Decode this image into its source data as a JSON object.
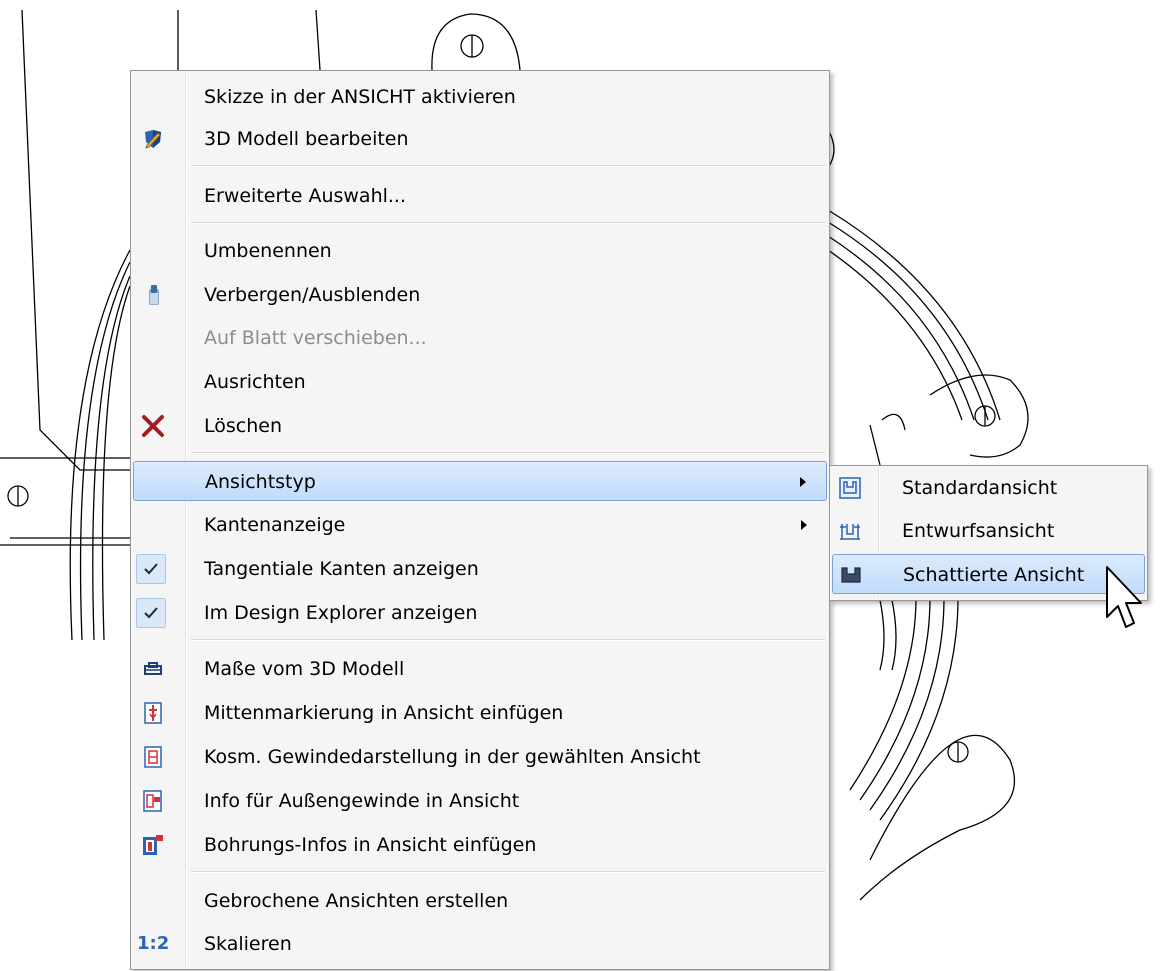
{
  "context_menu": {
    "items": {
      "skizze": "Skizze in der ANSICHT aktivieren",
      "modell": "3D Modell bearbeiten",
      "erweiterte": "Erweiterte Auswahl...",
      "umbenennen": "Umbenennen",
      "verbergen": "Verbergen/Ausblenden",
      "blatt": "Auf Blatt verschieben...",
      "ausrichten": "Ausrichten",
      "loeschen": "Löschen",
      "ansichtstyp": "Ansichtstyp",
      "kanten": "Kantenanzeige",
      "tangential": "Tangentiale Kanten anzeigen",
      "design_explorer": "Im Design Explorer anzeigen",
      "masse": "Maße vom 3D Modell",
      "mitten": "Mittenmarkierung in Ansicht einfügen",
      "gewinde": "Kosm. Gewindedarstellung in der gewählten Ansicht",
      "aussengewinde": "Info für Außengewinde in Ansicht",
      "bohrung": "Bohrungs-Infos in Ansicht einfügen",
      "gebrochen": "Gebrochene Ansichten erstellen",
      "skalieren": "Skalieren"
    },
    "scale_icon_text": "1:2",
    "highlighted_item": "Ansichtstyp",
    "disabled_item": "Auf Blatt verschieben...",
    "checked_items": [
      "Tangentiale Kanten anzeigen",
      "Im Design Explorer anzeigen"
    ]
  },
  "submenu": {
    "items": {
      "standard": "Standardansicht",
      "entwurf": "Entwurfsansicht",
      "schattiert": "Schattierte Ansicht"
    },
    "highlighted_item": "Schattierte Ansicht"
  },
  "icons": {
    "modell": "edit-3d-model-icon",
    "verbergen": "hide-icon",
    "loeschen": "delete-x-icon",
    "tangential": "checkmark-icon",
    "design_explorer": "checkmark-icon",
    "masse": "dimensions-from-model-icon",
    "mitten": "center-mark-icon",
    "gewinde": "cosmetic-thread-icon",
    "aussengewinde": "external-thread-info-icon",
    "bohrung": "hole-info-icon",
    "standard": "standard-view-icon",
    "entwurf": "draft-view-icon",
    "schattiert": "shaded-view-icon"
  },
  "colors": {
    "highlight_fill": "#c9dff9",
    "highlight_border": "#7da2ce",
    "menu_background": "#f5f5f5",
    "disabled_text": "#8d8d8d",
    "delete_icon": "#a11f24",
    "icon_blue": "#2b63b8",
    "icon_red": "#d0323a"
  }
}
